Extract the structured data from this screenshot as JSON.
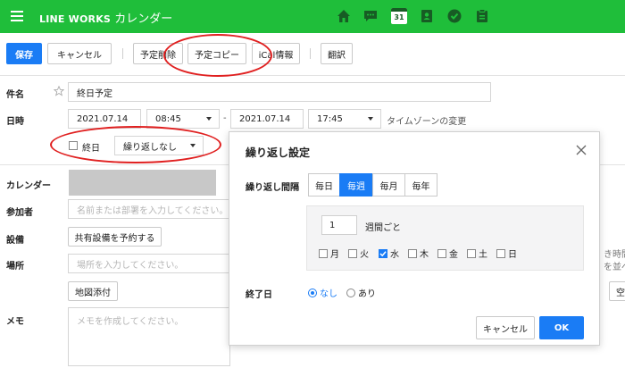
{
  "header": {
    "brand": "LINE WORKS",
    "app_title": "カレンダー",
    "calendar_day": "31",
    "icons": [
      "home-icon",
      "chat-icon",
      "calendar-icon",
      "contacts-icon",
      "task-check-icon",
      "clipboard-icon"
    ]
  },
  "toolbar": {
    "save": "保存",
    "cancel": "キャンセル",
    "delete": "予定削除",
    "copy": "予定コピー",
    "ical": "iCal情報",
    "translate": "翻訳"
  },
  "form": {
    "subject_label": "件名",
    "subject_value": "終日予定",
    "datetime_label": "日時",
    "start_date": "2021.07.14",
    "start_time": "08:45",
    "range_sep": "-",
    "end_date": "2021.07.14",
    "end_time": "17:45",
    "timezone_link": "タイムゾーンの変更",
    "allday_label": "終日",
    "repeat_value": "繰り返しなし",
    "calendar_label": "カレンダー",
    "participants_label": "参加者",
    "participants_placeholder": "名前または部署を入力してください。",
    "equipment_label": "設備",
    "equipment_button": "共有設備を予約する",
    "place_label": "場所",
    "place_placeholder": "場所を入力してください。",
    "map_button": "地図添付",
    "memo_label": "メモ",
    "memo_placeholder": "メモを作成してください。",
    "right_hint_1": "き時間帯",
    "right_hint_2": "を並べて",
    "right_button": "空"
  },
  "modal": {
    "title": "繰り返し設定",
    "interval_label": "繰り返し間隔",
    "options": [
      "毎日",
      "毎週",
      "毎月",
      "毎年"
    ],
    "active_option": "毎週",
    "interval_value": "1",
    "interval_unit": "週間ごと",
    "days": [
      {
        "label": "月",
        "checked": false
      },
      {
        "label": "火",
        "checked": false
      },
      {
        "label": "水",
        "checked": true
      },
      {
        "label": "木",
        "checked": false
      },
      {
        "label": "金",
        "checked": false
      },
      {
        "label": "土",
        "checked": false
      },
      {
        "label": "日",
        "checked": false
      }
    ],
    "end_label": "終了日",
    "end_none": "なし",
    "end_some": "あり",
    "end_selected": "なし",
    "cancel": "キャンセル",
    "ok": "OK"
  },
  "colors": {
    "header_green": "#1fbe3a",
    "primary_blue": "#1a7cf5",
    "annotation_red": "#e02020"
  }
}
